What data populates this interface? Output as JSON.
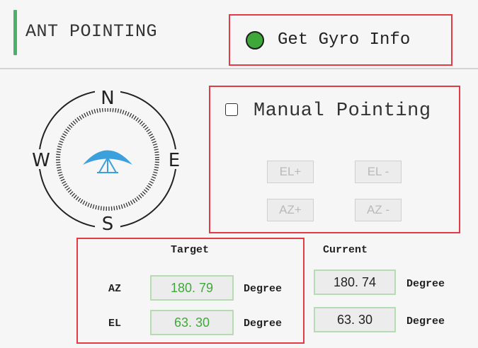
{
  "header": {
    "title": "ANT POINTING",
    "gyro_button_label": "Get Gyro Info",
    "gyro_status_color": "#3fa83a"
  },
  "compass": {
    "north": "N",
    "south": "S",
    "east": "E",
    "west": "W",
    "center_icon": "antenna-dish-icon"
  },
  "manual": {
    "checkbox_label": "Manual Pointing",
    "checked": false,
    "buttons": {
      "el_plus": "EL+",
      "el_minus": "EL -",
      "az_plus": "AZ+",
      "az_minus": "AZ -"
    }
  },
  "pointing": {
    "target_header": "Target",
    "current_header": "Current",
    "az_label": "AZ",
    "el_label": "EL",
    "target_az": "180. 79",
    "target_el": "63. 30",
    "current_az": "180. 74",
    "current_el": "63. 30",
    "unit": "Degree"
  },
  "colors": {
    "highlight_border": "#e23b45",
    "accent_green": "#4bb06a"
  }
}
